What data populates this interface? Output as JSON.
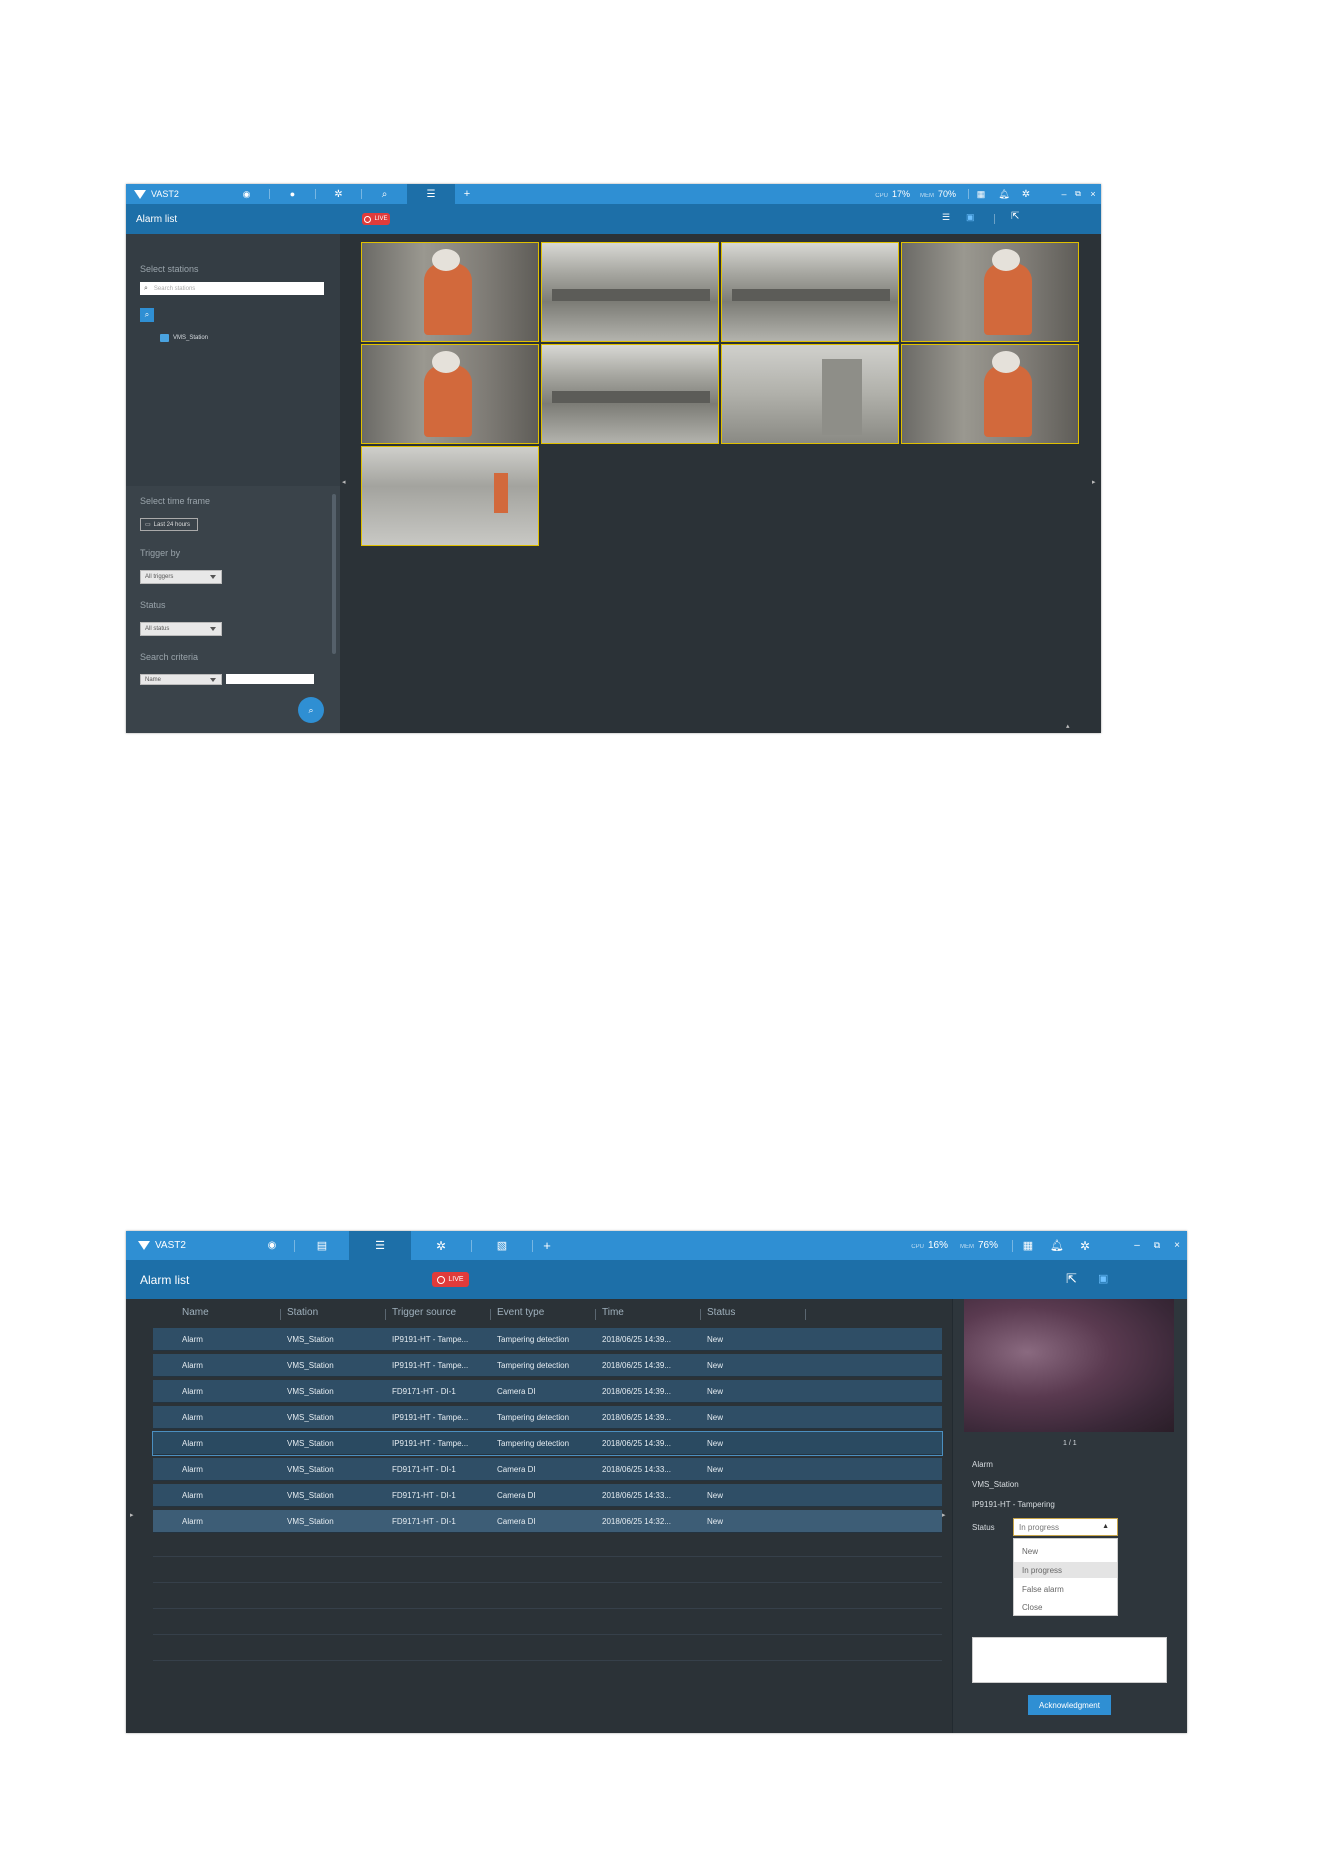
{
  "top_window": {
    "app_name": "VAST2",
    "stats": {
      "cpu_label": "CPU",
      "cpu": "17%",
      "mem_label": "MEM",
      "mem": "70%"
    },
    "title": "Alarm list",
    "live": "LIVE",
    "sidebar": {
      "select_stations": "Select stations",
      "search_placeholder": "Search stations",
      "station": "VMS_Station"
    },
    "filters": {
      "time_label": "Select time frame",
      "time_value": "Last 24 hours",
      "trigger_label": "Trigger by",
      "trigger_value": "All triggers",
      "status_label": "Status",
      "status_value": "All status",
      "criteria_label": "Search criteria",
      "criteria_value": "Name"
    },
    "icons": [
      "eye-icon",
      "map-pin-icon",
      "gear-icon",
      "search-person-icon",
      "alarm-list-icon",
      "plus-icon",
      "grid-icon",
      "bell-icon",
      "settings-icon",
      "minimize-icon",
      "restore-icon",
      "close-icon",
      "list-view-icon",
      "thumbnail-view-icon",
      "export-icon",
      "search-icon"
    ]
  },
  "bottom_window": {
    "app_name": "VAST2",
    "stats": {
      "cpu_label": "CPU",
      "cpu": "16%",
      "mem_label": "MEM",
      "mem": "76%"
    },
    "title": "Alarm list",
    "live": "LIVE",
    "columns": [
      "Name",
      "Station",
      "Trigger source",
      "Event type",
      "Time",
      "Status"
    ],
    "rows": [
      [
        "Alarm",
        "VMS_Station",
        "IP9191-HT - Tampe...",
        "Tampering detection",
        "2018/06/25 14:39...",
        "New"
      ],
      [
        "Alarm",
        "VMS_Station",
        "IP9191-HT - Tampe...",
        "Tampering detection",
        "2018/06/25 14:39...",
        "New"
      ],
      [
        "Alarm",
        "VMS_Station",
        "FD9171-HT - DI-1",
        "Camera DI",
        "2018/06/25 14:39...",
        "New"
      ],
      [
        "Alarm",
        "VMS_Station",
        "IP9191-HT - Tampe...",
        "Tampering detection",
        "2018/06/25 14:39...",
        "New"
      ],
      [
        "Alarm",
        "VMS_Station",
        "IP9191-HT - Tampe...",
        "Tampering detection",
        "2018/06/25 14:39...",
        "New"
      ],
      [
        "Alarm",
        "VMS_Station",
        "FD9171-HT - DI-1",
        "Camera DI",
        "2018/06/25 14:33...",
        "New"
      ],
      [
        "Alarm",
        "VMS_Station",
        "FD9171-HT - DI-1",
        "Camera DI",
        "2018/06/25 14:33...",
        "New"
      ],
      [
        "Alarm",
        "VMS_Station",
        "FD9171-HT - DI-1",
        "Camera DI",
        "2018/06/25 14:32...",
        "New"
      ]
    ],
    "detail": {
      "pager": "1 / 1",
      "name": "Alarm",
      "station": "VMS_Station",
      "source": "IP9191-HT - Tampering",
      "status_label": "Status",
      "status_value": "In progress",
      "options": [
        "New",
        "In progress",
        "False alarm",
        "Close"
      ],
      "ack_button": "Acknowledgment"
    }
  }
}
